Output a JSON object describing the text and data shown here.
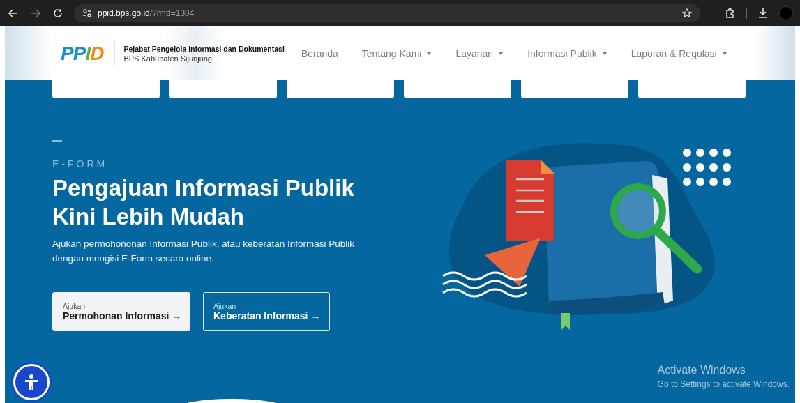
{
  "browser": {
    "url_host": "ppid.bps.go.id",
    "url_path": "/?mfd=1304",
    "forward_disabled": true
  },
  "header": {
    "logo": "PPID",
    "org_title": "Pejabat Pengelola Informasi dan Dokumentasi",
    "org_subtitle": "BPS Kabupaten Sijunjung",
    "nav": [
      {
        "label": "Beranda",
        "dropdown": false
      },
      {
        "label": "Tentang Kami",
        "dropdown": true
      },
      {
        "label": "Layanan",
        "dropdown": true
      },
      {
        "label": "Informasi Publik",
        "dropdown": true
      },
      {
        "label": "Laporan & Regulasi",
        "dropdown": true
      }
    ]
  },
  "hero": {
    "eyebrow": "E-FORM",
    "title_lines": [
      "Pengajuan Informasi Publik",
      "Kini Lebih Mudah"
    ],
    "description": "Ajukan permohononan Informasi Publik, atau keberatan Informasi Publik dengan mengisi E-Form secara online.",
    "buttons": [
      {
        "kicker": "Ajukan",
        "label": "Permohonan Informasi →",
        "kind": "solid"
      },
      {
        "kicker": "Ajukan",
        "label": "Keberatan Informasi →",
        "kind": "outline"
      }
    ]
  },
  "os_notice": {
    "title": "Activate Windows",
    "message": "Go to Settings to activate Windows."
  }
}
